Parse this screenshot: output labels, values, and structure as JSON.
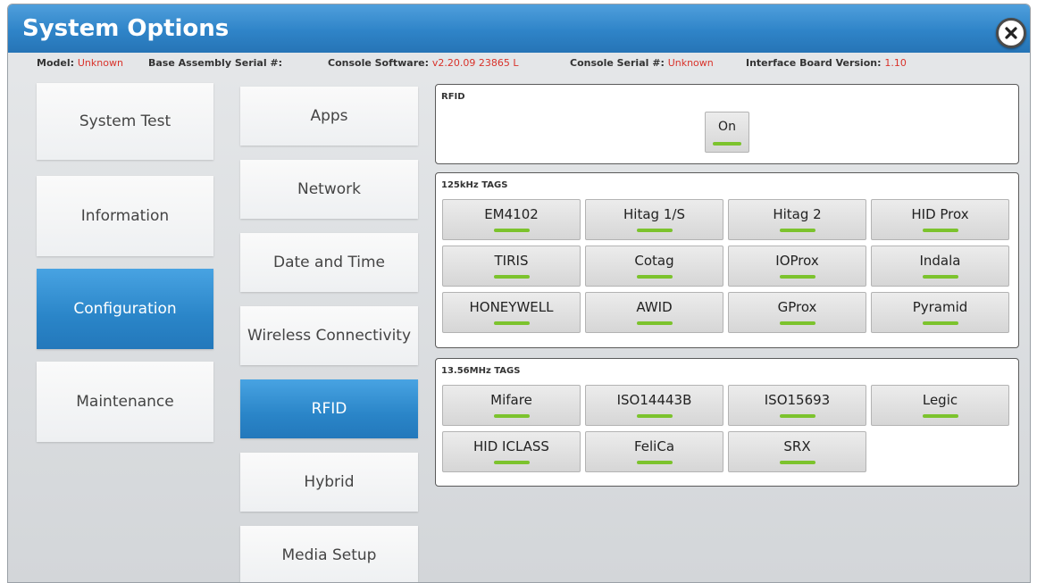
{
  "title": "System Options",
  "info": {
    "model_label": "Model:",
    "model_value": "Unknown",
    "base_serial_label": "Base Assembly Serial #:",
    "console_sw_label": "Console Software:",
    "console_sw_value": "v2.20.09 23865 L",
    "console_serial_label": "Console Serial #:",
    "console_serial_value": "Unknown",
    "interface_label": "Interface Board Version:",
    "interface_value": "1.10"
  },
  "nav_main": [
    {
      "label": "System Test",
      "active": false
    },
    {
      "label": "Information",
      "active": false
    },
    {
      "label": "Configuration",
      "active": true
    },
    {
      "label": "Maintenance",
      "active": false
    }
  ],
  "nav_sub": [
    {
      "label": "Apps",
      "active": false
    },
    {
      "label": "Network",
      "active": false
    },
    {
      "label": "Date and Time",
      "active": false
    },
    {
      "label": "Wireless Connectivity",
      "active": false
    },
    {
      "label": "RFID",
      "active": true
    },
    {
      "label": "Hybrid",
      "active": false
    },
    {
      "label": "Media Setup",
      "active": false
    }
  ],
  "rfid": {
    "title": "RFID",
    "toggle_label": "On"
  },
  "tags_125": {
    "title": "125kHz TAGS",
    "items": [
      "EM4102",
      "Hitag 1/S",
      "Hitag 2",
      "HID Prox",
      "TIRIS",
      "Cotag",
      "IOProx",
      "Indala",
      "HONEYWELL",
      "AWID",
      "GProx",
      "Pyramid"
    ]
  },
  "tags_1356": {
    "title": "13.56MHz TAGS",
    "items": [
      "Mifare",
      "ISO14443B",
      "ISO15693",
      "Legic",
      "HID ICLASS",
      "FeliCa",
      "SRX"
    ]
  },
  "colors": {
    "accent": "#2f84c8",
    "value_red": "#d9322a",
    "indicator_green": "#7cc32d"
  }
}
